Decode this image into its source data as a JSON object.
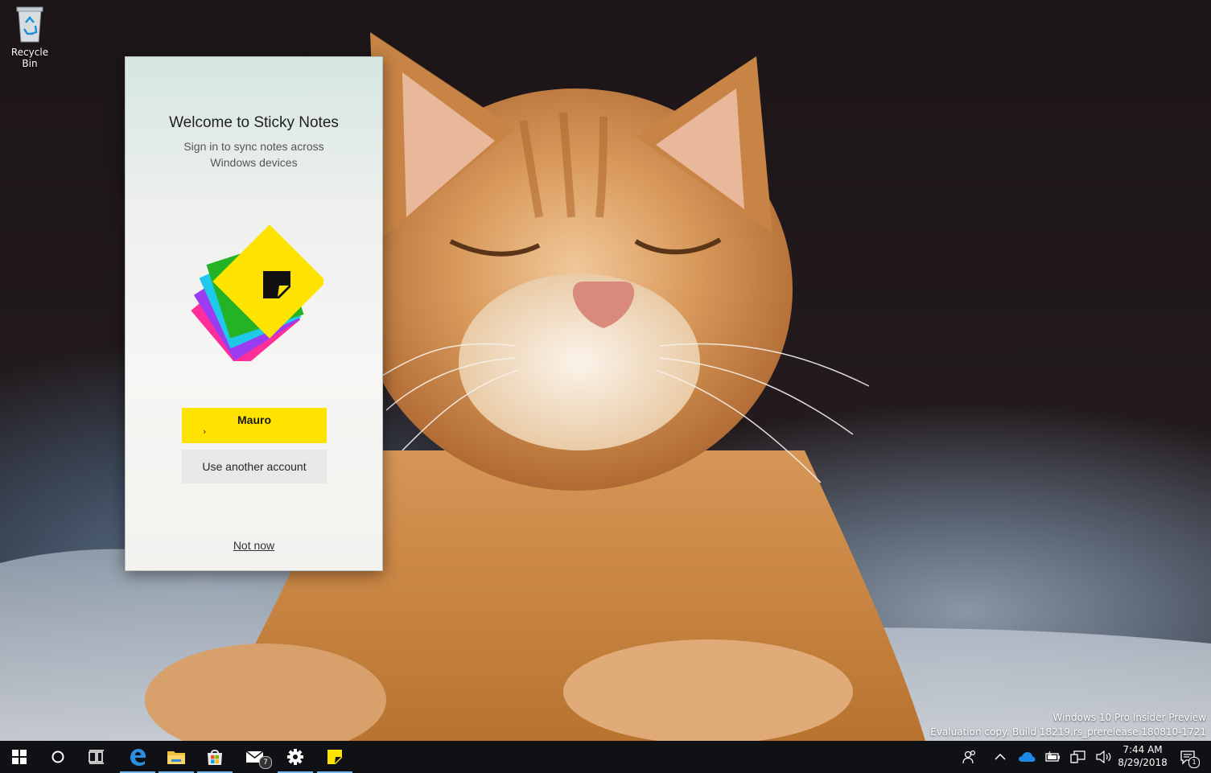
{
  "desktop": {
    "recycle_bin_label": "Recycle Bin",
    "watermark_line1": "Windows 10 Pro Insider Preview",
    "watermark_line2": "Evaluation copy. Build 18219.rs_prerelease.180810-1721"
  },
  "sticky_notes": {
    "title": "Welcome to Sticky Notes",
    "subtitle_line1": "Sign in to sync notes across",
    "subtitle_line2": "Windows devices",
    "account_name": "Mauro",
    "account_chevron": "›",
    "other_account_label": "Use another account",
    "not_now_label": "Not now",
    "accent_color": "#ffe300"
  },
  "taskbar": {
    "items": [
      {
        "name": "start",
        "icon": "windows-logo-icon"
      },
      {
        "name": "cortana",
        "icon": "circle-icon"
      },
      {
        "name": "task-view",
        "icon": "task-view-icon"
      },
      {
        "name": "edge",
        "icon": "edge-icon",
        "active": true
      },
      {
        "name": "file-explorer",
        "icon": "folder-icon",
        "active": true
      },
      {
        "name": "store",
        "icon": "store-icon",
        "active": true
      },
      {
        "name": "mail",
        "icon": "mail-icon",
        "badge": "7"
      },
      {
        "name": "settings",
        "icon": "gear-icon",
        "active": true
      },
      {
        "name": "sticky-notes",
        "icon": "sticky-notes-icon",
        "active": true
      }
    ],
    "mail_badge": "7",
    "tray_icons": [
      "people-icon",
      "chevron-up-icon",
      "onedrive-icon",
      "battery-icon",
      "network-icon",
      "volume-icon"
    ],
    "time": "7:44 AM",
    "date": "8/29/2018",
    "notification_count": "1"
  }
}
